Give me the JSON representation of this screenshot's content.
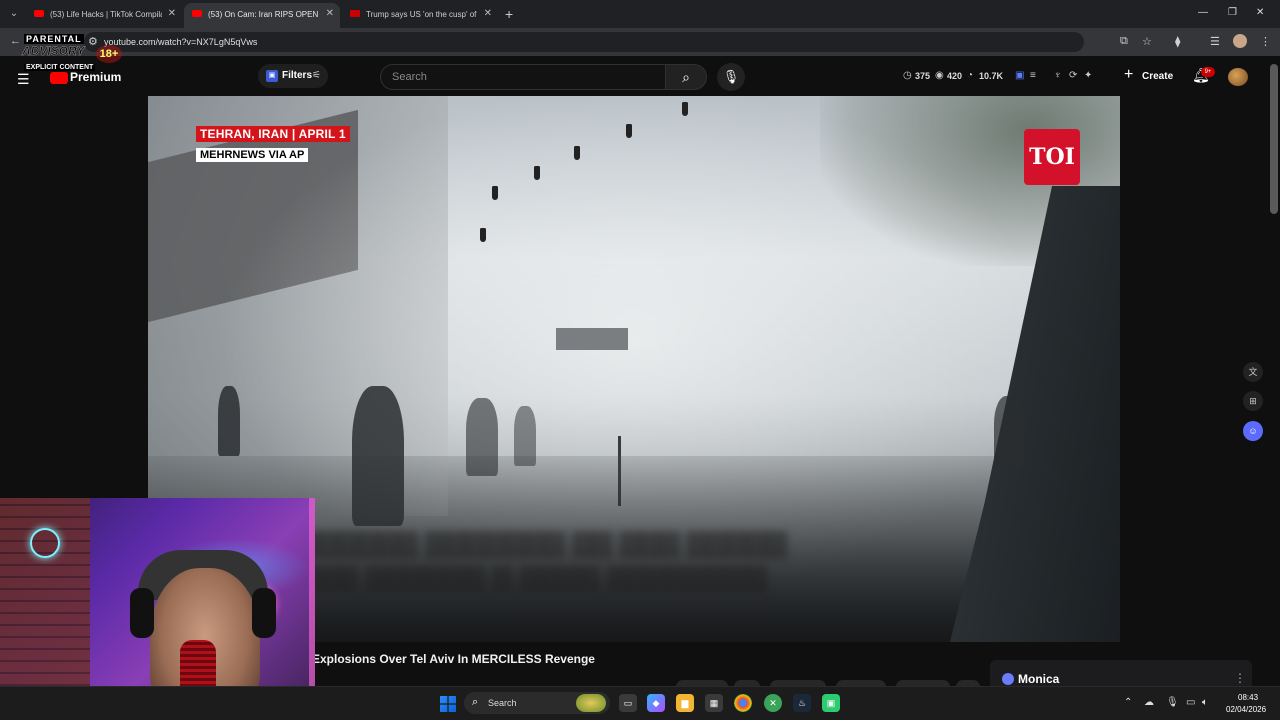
{
  "browser": {
    "tabs": [
      {
        "title": "(53) Life Hacks | TikTok Compila",
        "active": false
      },
      {
        "title": "(53) On Cam: Iran RIPS OPEN Is",
        "active": true
      },
      {
        "title": "Trump says US 'on the cusp' of",
        "active": false
      }
    ],
    "url": "youtube.com/watch?v=NX7LgN5qVws"
  },
  "overlay": {
    "advisory_line1": "PARENTAL",
    "advisory_line2": "ADVISORY",
    "advisory_line3": "EXPLICIT CONTENT",
    "age_badge": "18+"
  },
  "youtube": {
    "logo_text": "Premium",
    "filters_label": "Filters",
    "search_placeholder": "Search",
    "stats": [
      "375",
      "420",
      "10.7K"
    ],
    "create_label": "Create",
    "notification_count": "9+"
  },
  "video": {
    "location_tag": "TEHRAN, IRAN | APRIL 1",
    "source_tag": "MEHRNEWS VIA AP",
    "channel_bug": "TOI",
    "title_partial": "Explosions Over Tel Aviv In MERCILESS Revenge"
  },
  "monica": {
    "label": "Monica"
  },
  "taskbar": {
    "search_label": "Search",
    "time": "08:43",
    "date": "02/04/2026"
  },
  "colors": {
    "yt_red": "#ff0000",
    "toi_red": "#d3112a",
    "location_tag_red": "#d4141b",
    "notification_red": "#cc0000"
  }
}
